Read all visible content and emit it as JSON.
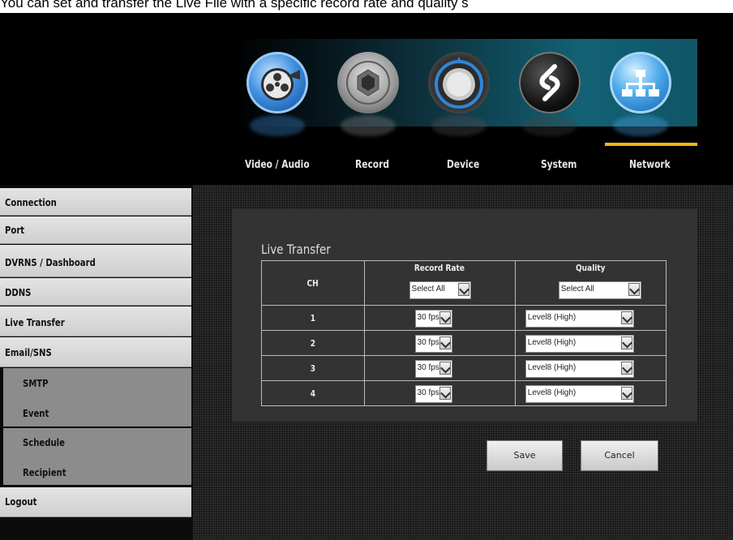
{
  "caption": "You can set and transfer the Live File with a specific record rate and quality s",
  "top_tabs": [
    {
      "label": "Video / Audio",
      "icon": "film-reel-icon"
    },
    {
      "label": "Record",
      "icon": "camera-lens-icon"
    },
    {
      "label": "Device",
      "icon": "power-knob-icon"
    },
    {
      "label": "System",
      "icon": "system-logo-icon"
    },
    {
      "label": "Network",
      "icon": "network-tree-icon",
      "selected": true
    }
  ],
  "accent_color": "#f2b414",
  "sidebar": {
    "items": [
      {
        "label": "Connection"
      },
      {
        "label": "Port"
      },
      {
        "label": "DVRNS / Dashboard"
      },
      {
        "label": "DDNS"
      },
      {
        "label": "Live Transfer"
      },
      {
        "label": "Email/SNS"
      }
    ],
    "sub_items": [
      {
        "label": "SMTP"
      },
      {
        "label": "Event"
      },
      {
        "label": "Schedule"
      },
      {
        "label": "Recipient"
      }
    ],
    "logout": "Logout"
  },
  "panel": {
    "title": "Live Transfer",
    "headers": {
      "ch": "CH",
      "record_rate": "Record Rate",
      "quality": "Quality",
      "select_all_rate": "Select All",
      "select_all_quality": "Select All"
    },
    "rows": [
      {
        "ch": "1",
        "rate": "30 fps",
        "quality": "Level8 (High)"
      },
      {
        "ch": "2",
        "rate": "30 fps",
        "quality": "Level8 (High)"
      },
      {
        "ch": "3",
        "rate": "30 fps",
        "quality": "Level8 (High)"
      },
      {
        "ch": "4",
        "rate": "30 fps",
        "quality": "Level8 (High)"
      }
    ]
  },
  "buttons": {
    "save": "Save",
    "cancel": "Cancel"
  }
}
